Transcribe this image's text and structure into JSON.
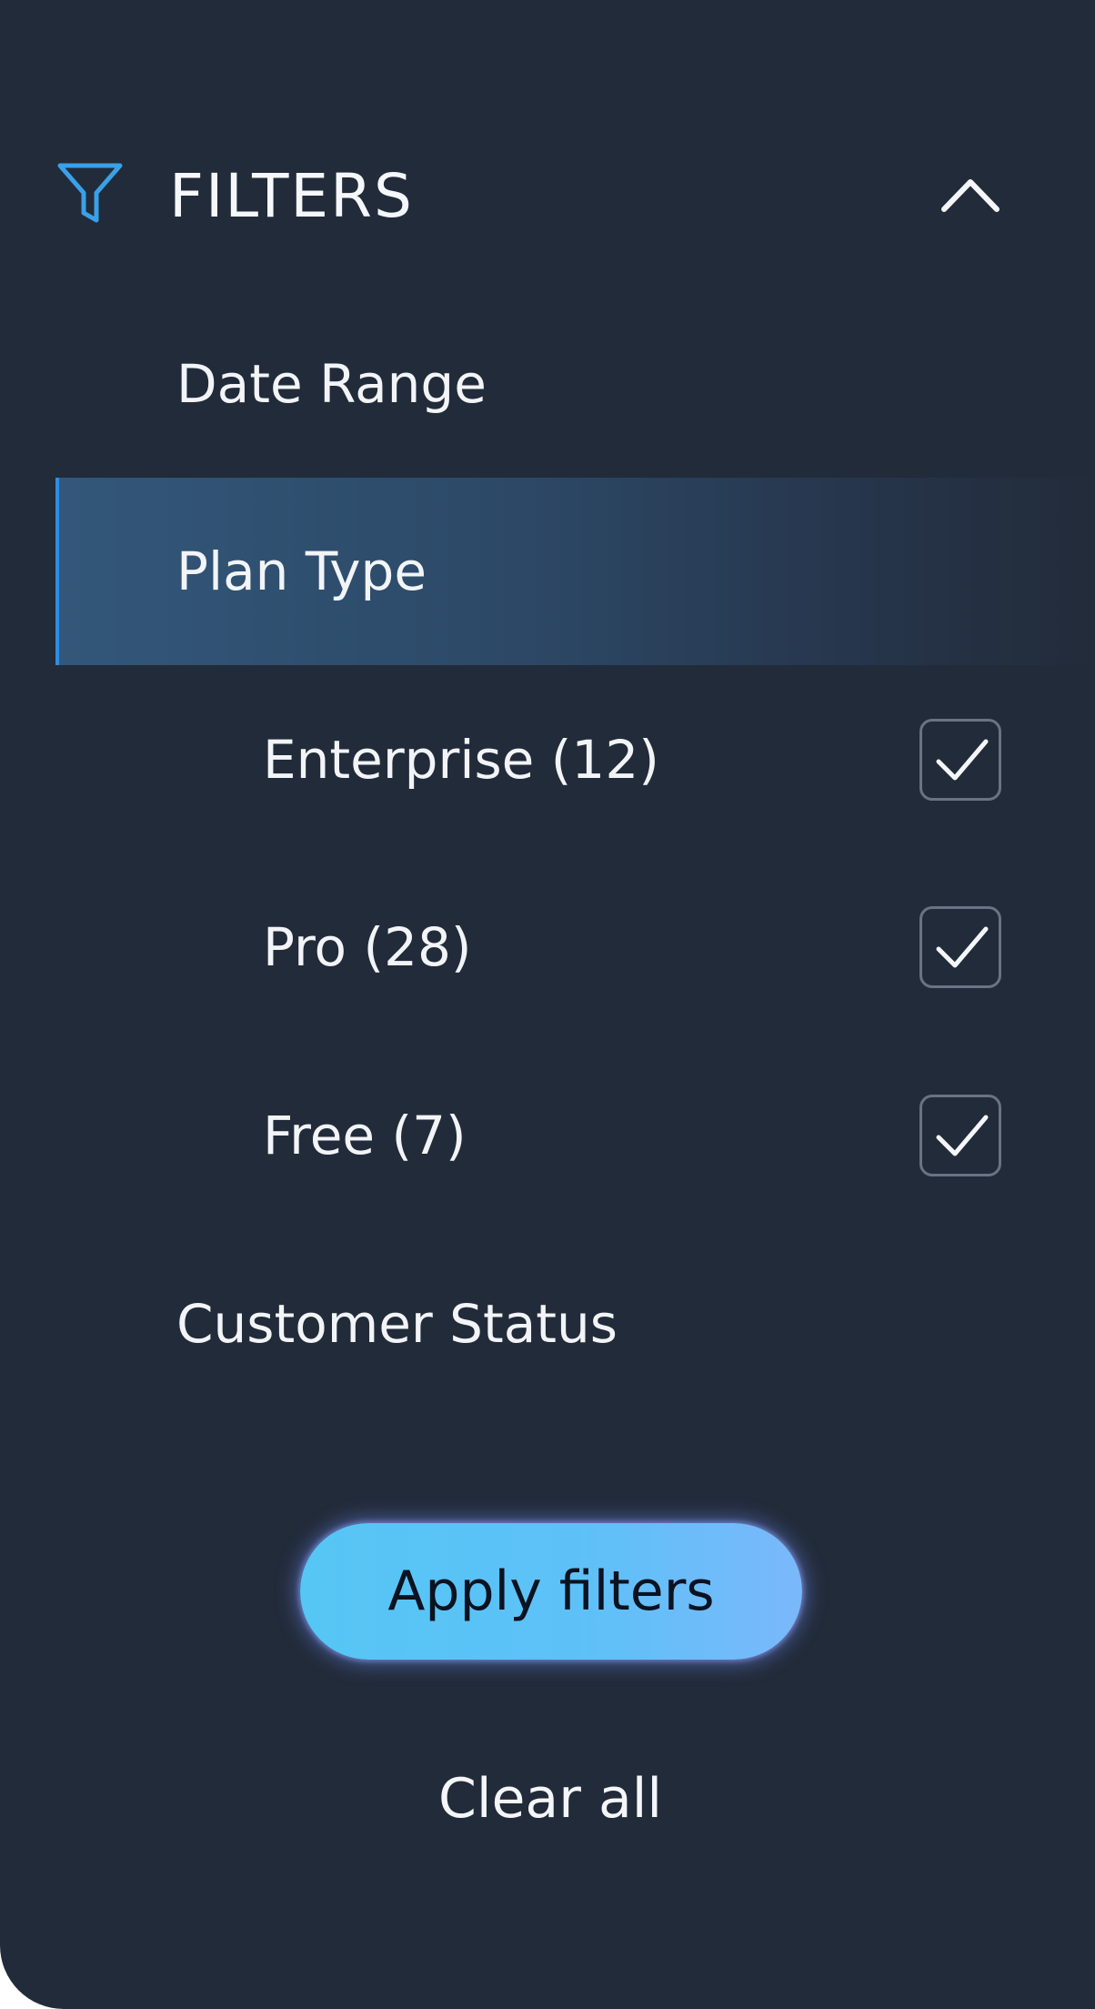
{
  "header": {
    "title": "FILTERS",
    "icons": {
      "filter": "funnel-icon",
      "collapse": "chevron-up-icon"
    },
    "accent_color": "#3aa0e8"
  },
  "sections": [
    {
      "label": "Date Range",
      "active": false
    },
    {
      "label": "Plan Type",
      "active": true
    },
    {
      "label": "Customer Status",
      "active": false
    }
  ],
  "plan_type_options": [
    {
      "label": "Enterprise (12)",
      "checked": true
    },
    {
      "label": "Pro (28)",
      "checked": true
    },
    {
      "label": "Free (7)",
      "checked": true
    }
  ],
  "actions": {
    "apply_label": "Apply filters",
    "clear_label": "Clear all"
  },
  "colors": {
    "panel_bg": "#222b39",
    "active_row": "#33577a",
    "active_indicator": "#2f8de4",
    "apply_button": "#5dc1f8"
  }
}
